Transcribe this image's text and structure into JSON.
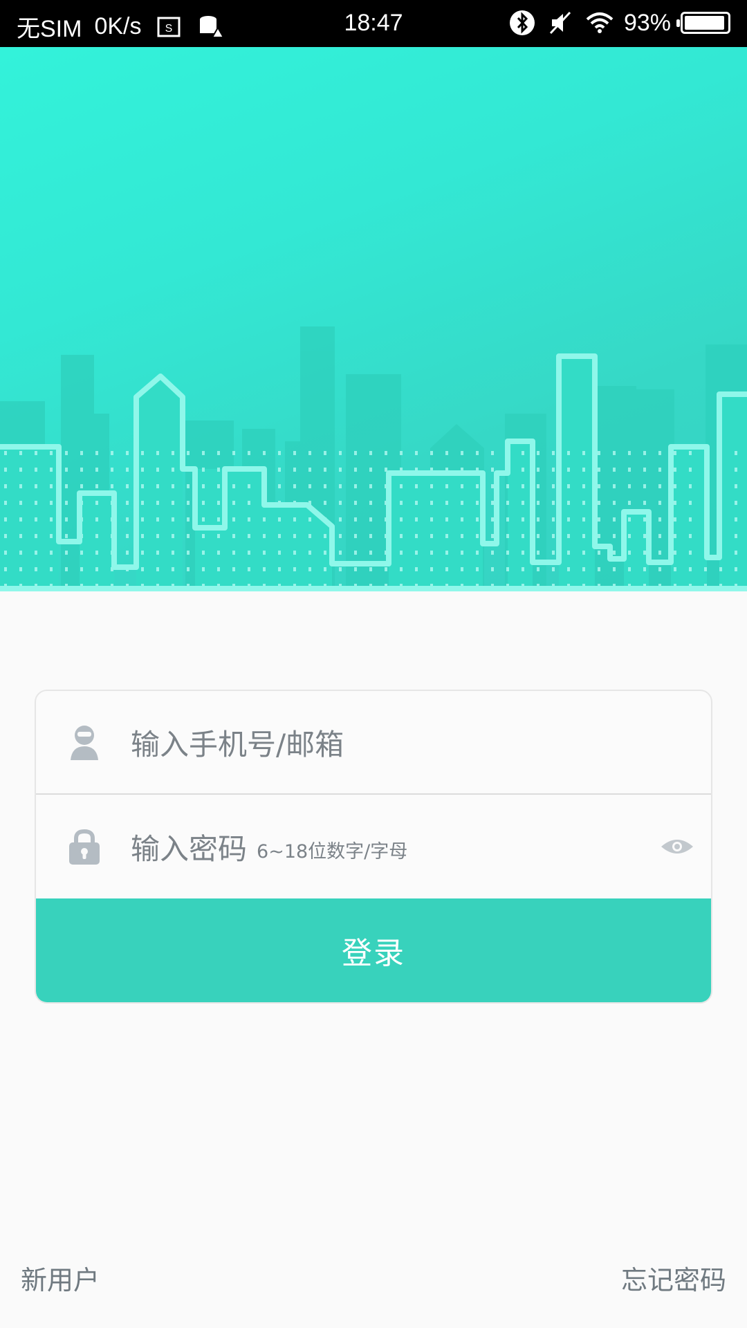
{
  "status_bar": {
    "carrier": "无SIM",
    "speed": "0K/s",
    "time": "18:47",
    "battery": "93%",
    "icons": [
      "screenshot-icon",
      "storage-warning-icon",
      "bluetooth-icon",
      "mute-icon",
      "wifi-icon",
      "battery-icon"
    ]
  },
  "hero": {
    "illustration": "city-skyline",
    "colors": {
      "top": "#33f2da",
      "bottom": "#36d2c2",
      "outline": "#8ff7ea"
    }
  },
  "form": {
    "username_placeholder": "输入手机号/邮箱",
    "password_placeholder": "输入密码",
    "password_hint": "6~18位数字/字母",
    "login_label": "登录"
  },
  "footer": {
    "new_user": "新用户",
    "forgot_password": "忘记密码"
  },
  "colors": {
    "accent": "#38d2bc",
    "text_muted": "#7b8288",
    "icon_gray": "#b4bcc3"
  }
}
